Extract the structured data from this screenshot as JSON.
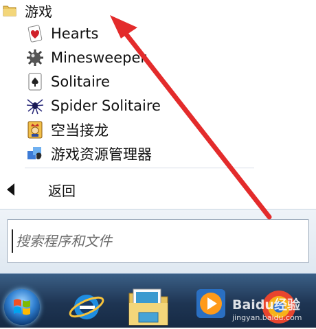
{
  "start_menu": {
    "folder_label": "游戏",
    "items": [
      {
        "label": "Hearts",
        "icon": "hearts-card-icon"
      },
      {
        "label": "Minesweeper",
        "icon": "mine-icon"
      },
      {
        "label": "Solitaire",
        "icon": "solitaire-card-icon"
      },
      {
        "label": "Spider Solitaire",
        "icon": "spider-icon"
      },
      {
        "label": "空当接龙",
        "icon": "king-card-icon"
      },
      {
        "label": "游戏资源管理器",
        "icon": "game-explorer-icon"
      }
    ],
    "back_label": "返回",
    "search_placeholder": "搜索程序和文件"
  },
  "taskbar": {
    "icons": [
      "start-orb-icon",
      "internet-explorer-icon",
      "file-explorer-icon",
      "media-player-icon",
      "browser-icon"
    ]
  },
  "watermark": {
    "main": "Baidu经验",
    "sub": "jingyan.baidu.com"
  },
  "colors": {
    "annotation_arrow": "#e32b2b",
    "taskbar": "#1e3553"
  }
}
